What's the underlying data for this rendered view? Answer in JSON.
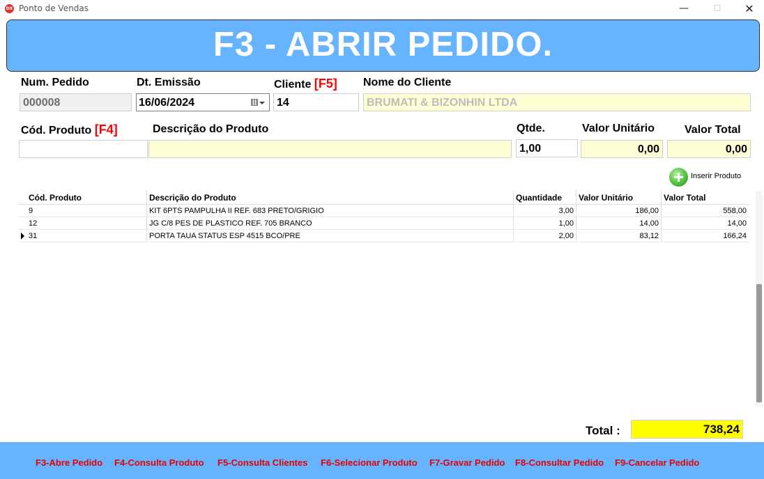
{
  "window": {
    "title": "Ponto de Vendas",
    "icon_text": "DX",
    "min_label": "—",
    "max_label": "☐",
    "close_label": "✕"
  },
  "banner": {
    "text": "F3 - ABRIR PEDIDO."
  },
  "header": {
    "num_pedido_label": "Num. Pedido",
    "num_pedido_value": "000008",
    "dt_emissao_label": "Dt. Emissão",
    "dt_emissao_value": "16/06/2024",
    "cliente_label": "Cliente",
    "cliente_key": "[F5]",
    "cliente_value": "14",
    "nome_cliente_label": "Nome do Cliente",
    "nome_cliente_value": "BRUMATI & BIZONHIN LTDA"
  },
  "product_entry": {
    "cod_label": "Cód. Produto",
    "cod_key": "[F4]",
    "cod_value": "",
    "desc_label": "Descrição do Produto",
    "desc_value": "",
    "qtde_label": "Qtde.",
    "qtde_value": "1,00",
    "valor_unit_label": "Valor Unitário",
    "valor_unit_value": "0,00",
    "valor_total_label": "Valor Total",
    "valor_total_value": "0,00",
    "insert_label": "Inserir Produto"
  },
  "grid": {
    "headers": {
      "cod": "Cód. Produto",
      "desc": "Descrição do Produto",
      "qtd": "Quantidade",
      "vu": "Valor Unitário",
      "vt": "Valor Total"
    },
    "rows": [
      {
        "cod": "9",
        "desc": "KIT 6PTS PAMPULHA II REF. 683 PRETO/GRIGIO",
        "qtd": "3,00",
        "vu": "186,00",
        "vt": "558,00"
      },
      {
        "cod": "12",
        "desc": "JG C/8 PES DE PLASTICO REF. 705 BRANCO",
        "qtd": "1,00",
        "vu": "14,00",
        "vt": "14,00"
      },
      {
        "cod": "31",
        "desc": "PORTA TAUA STATUS ESP 4515 BCO/PRE",
        "qtd": "2,00",
        "vu": "83,12",
        "vt": "166,24"
      }
    ]
  },
  "total": {
    "label": "Total  :",
    "value": "738,24"
  },
  "footer": {
    "f3": "F3-Abre Pedido",
    "f4": "F4-Consulta Produto",
    "f5": "F5-Consulta Clientes",
    "f6": "F6-Selecionar Produto",
    "f7": "F7-Gravar Pedido",
    "f8": "F8-Consultar Pedido",
    "f9": "F9-Cancelar Pedido"
  },
  "colors": {
    "banner": "#66b3ff",
    "footer": "#66b3ff",
    "function_key": "#ff0000",
    "total_bg": "#ffff00",
    "readonly_bg": "#ffffd6"
  }
}
